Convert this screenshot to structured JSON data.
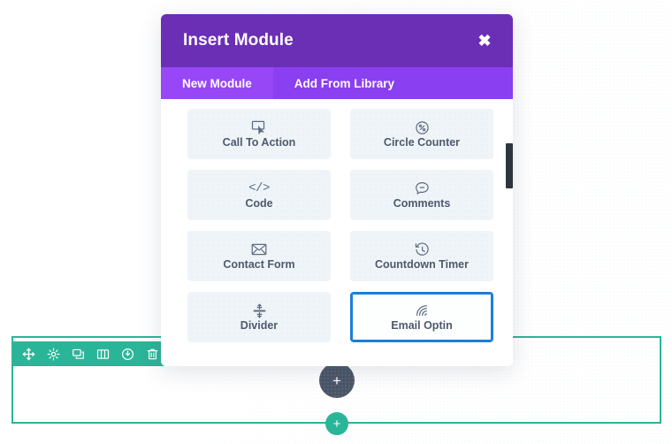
{
  "modal": {
    "title": "Insert Module",
    "close_label": "✖",
    "tabs": [
      {
        "label": "New Module",
        "active": true
      },
      {
        "label": "Add From Library",
        "active": false
      }
    ],
    "modules": [
      {
        "label": "Call To Action",
        "icon": "cursor-box-icon",
        "selected": false
      },
      {
        "label": "Circle Counter",
        "icon": "circle-percent-icon",
        "selected": false
      },
      {
        "label": "Code",
        "icon": "code-brackets-icon",
        "selected": false
      },
      {
        "label": "Comments",
        "icon": "speech-bubble-icon",
        "selected": false
      },
      {
        "label": "Contact Form",
        "icon": "envelope-icon",
        "selected": false
      },
      {
        "label": "Countdown Timer",
        "icon": "clock-rewind-icon",
        "selected": false
      },
      {
        "label": "Divider",
        "icon": "divider-icon",
        "selected": false
      },
      {
        "label": "Email Optin",
        "icon": "rss-signal-icon",
        "selected": true
      }
    ],
    "scrollbar": {
      "name": "module-list-scrollbar"
    }
  },
  "builder": {
    "section_toolbar": [
      {
        "name": "move-icon",
        "title": "Move"
      },
      {
        "name": "gear-icon",
        "title": "Settings"
      },
      {
        "name": "duplicate-icon",
        "title": "Duplicate"
      },
      {
        "name": "columns-icon",
        "title": "Columns"
      },
      {
        "name": "save-icon",
        "title": "Save"
      },
      {
        "name": "trash-icon",
        "title": "Delete"
      }
    ],
    "module_add_label": "+",
    "row_add_label": "+"
  },
  "colors": {
    "modal_header": "#6b2fb5",
    "modal_tabs": "#8a3ff0",
    "tab_active": "#9747f5",
    "card_bg": "#eff4f8",
    "card_selected_border": "#1c7ed6",
    "builder_green": "#2bb598",
    "handle_dark": "#4a5567",
    "scrollbar_thumb": "#2f353c"
  }
}
